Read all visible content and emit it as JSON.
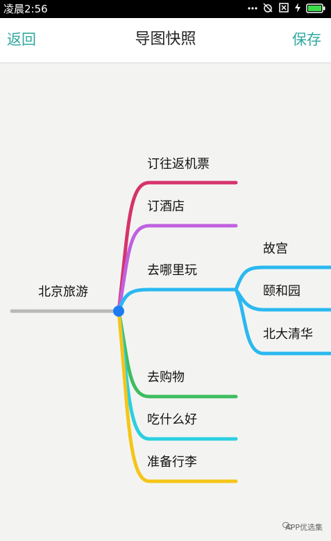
{
  "status_bar": {
    "time": "凌晨2:56"
  },
  "nav": {
    "back": "返回",
    "title": "导图快照",
    "save": "保存"
  },
  "mindmap": {
    "root": "北京旅游",
    "branches": [
      {
        "label": "订往返机票",
        "color": "#d6336c"
      },
      {
        "label": "订酒店",
        "color": "#c061e0"
      },
      {
        "label": "去哪里玩",
        "color": "#2bb8f0",
        "children": [
          {
            "label": "故宫"
          },
          {
            "label": "颐和园"
          },
          {
            "label": "北大清华"
          }
        ]
      },
      {
        "label": "去购物",
        "color": "#3ebd5f"
      },
      {
        "label": "吃什么好",
        "color": "#2ccfe0"
      },
      {
        "label": "准备行李",
        "color": "#f5c518"
      }
    ],
    "root_line_color": "#b9b9b9",
    "hub_color": "#1e7cf2"
  },
  "watermark": "APP优选集"
}
